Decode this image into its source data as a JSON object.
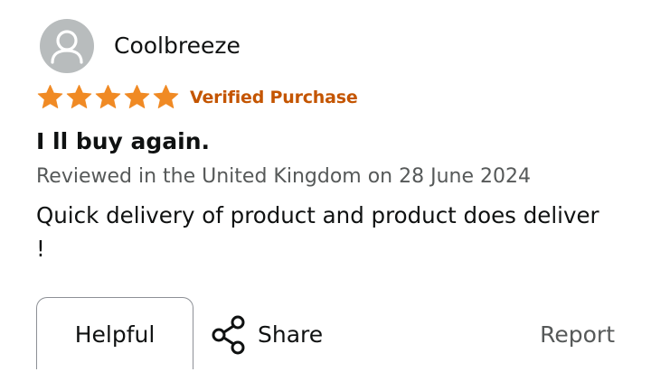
{
  "review": {
    "reviewer_name": "Coolbreeze",
    "rating": 5,
    "rating_max": 5,
    "verified_label": "Verified Purchase",
    "title": "I ll buy again.",
    "meta": "Reviewed in the United Kingdom on 28 June 2024",
    "body": "Quick delivery of product and product does deliver !"
  },
  "actions": {
    "helpful_label": "Helpful",
    "share_label": "Share",
    "report_label": "Report"
  },
  "colors": {
    "star": "#f08a24",
    "verified": "#c45500",
    "meta_text": "#565959",
    "avatar_bg": "#b8bcbd"
  },
  "icons": {
    "avatar": "user-icon",
    "star": "star-icon",
    "share": "share-icon"
  }
}
